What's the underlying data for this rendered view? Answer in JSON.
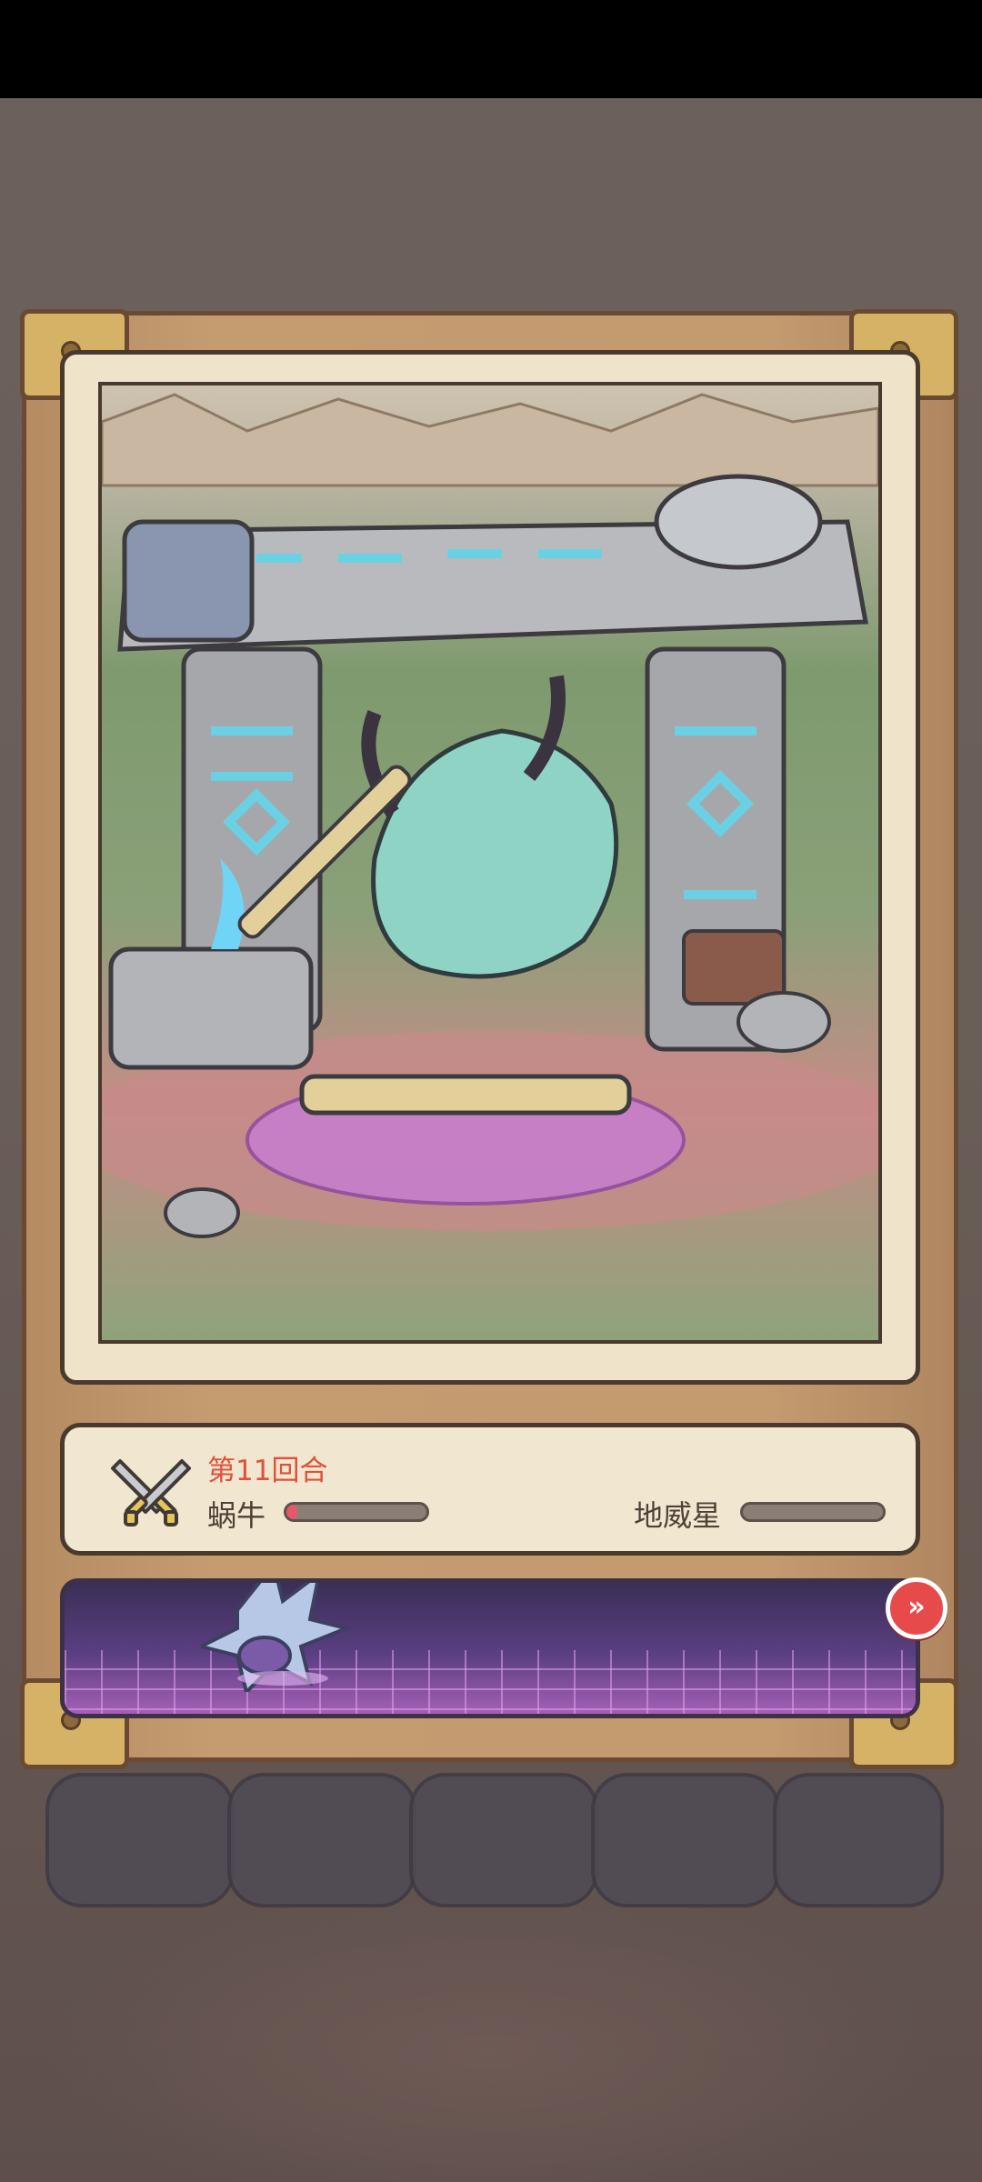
{
  "battle": {
    "round_label": "第11回合",
    "player": {
      "name": "蜗牛",
      "hp_fraction": 0.08
    },
    "enemy": {
      "name": "地威星",
      "hp_fraction": 0.0
    }
  },
  "controls": {
    "fast_forward_icon": "double-chevron-right-icon",
    "fast_forward_symbol": "»"
  },
  "colors": {
    "round_label": "#e0513b",
    "hp_fill": "#e8576c",
    "fast_forward": "#e64a4a"
  }
}
